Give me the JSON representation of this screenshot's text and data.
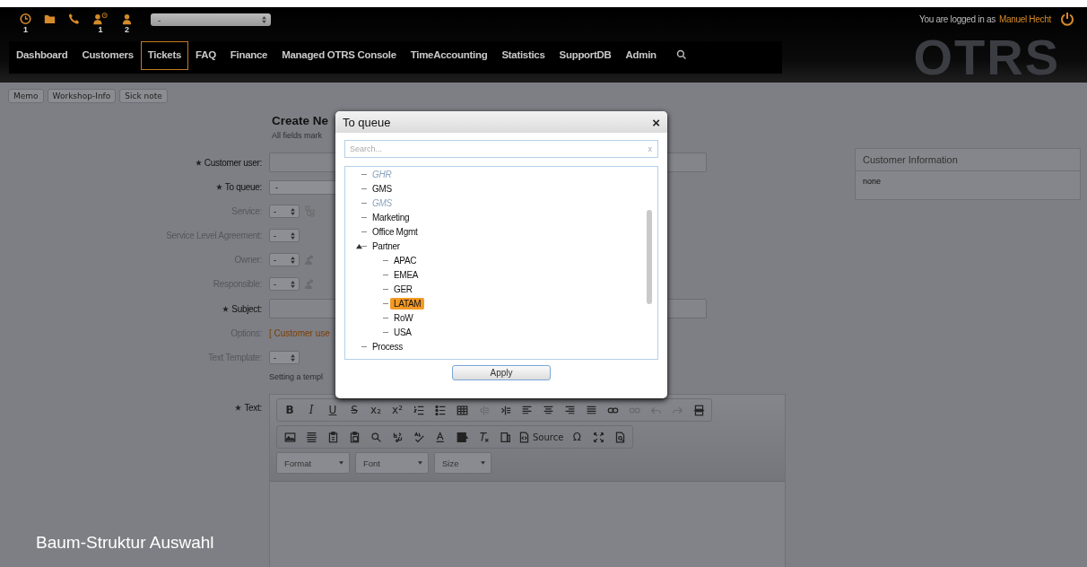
{
  "header": {
    "icons": [
      {
        "kind": "clock",
        "count": "1"
      },
      {
        "kind": "folder"
      },
      {
        "kind": "phone"
      },
      {
        "kind": "reminder",
        "count": "1"
      },
      {
        "kind": "person",
        "count": "2"
      }
    ],
    "queue_select": {
      "value": "-"
    },
    "logo": "OTRS",
    "login_text": "You are logged in as",
    "user": "Manuel Hecht"
  },
  "nav": [
    {
      "label": "Dashboard",
      "selected": false
    },
    {
      "label": "Customers",
      "selected": false
    },
    {
      "label": "Tickets",
      "selected": true
    },
    {
      "label": "FAQ",
      "selected": false
    },
    {
      "label": "Finance",
      "selected": false
    },
    {
      "label": "Managed OTRS Console",
      "selected": false
    },
    {
      "label": "TimeAccounting",
      "selected": false
    },
    {
      "label": "Statistics",
      "selected": false
    },
    {
      "label": "SupportDB",
      "selected": false
    },
    {
      "label": "Admin",
      "selected": false
    }
  ],
  "quick_buttons": [
    "Memo",
    "Workshop-Info",
    "Sick note"
  ],
  "form": {
    "title": "Create Ne",
    "hint": "All fields mark",
    "rows": [
      {
        "label": "Customer user:",
        "required": true,
        "kind": "input"
      },
      {
        "label": "To queue:",
        "required": true,
        "kind": "wide-select",
        "value": "-"
      },
      {
        "label": "Service:",
        "required": false,
        "kind": "select",
        "value": "-"
      },
      {
        "label": "Service Level Agreement:",
        "required": false,
        "kind": "select",
        "value": "-"
      },
      {
        "label": "Owner:",
        "required": false,
        "kind": "select",
        "value": "-"
      },
      {
        "label": "Responsible:",
        "required": false,
        "kind": "select",
        "value": "-"
      },
      {
        "label": "Subject:",
        "required": true,
        "kind": "input"
      },
      {
        "label": "Options:",
        "required": false,
        "kind": "link",
        "value": "[ Customer use"
      },
      {
        "label": "Text Template:",
        "required": false,
        "kind": "select",
        "value": "-",
        "note": "Setting a templ"
      }
    ],
    "text_label": "Text:",
    "text_required": true
  },
  "editor": {
    "toolbar_rows": [
      [
        {
          "kind": "char",
          "label": "B",
          "disabled": false
        },
        {
          "kind": "char",
          "label": "I",
          "disabled": false
        },
        {
          "kind": "char",
          "label": "U",
          "disabled": false
        },
        {
          "kind": "char",
          "label": "S",
          "disabled": false
        },
        {
          "kind": "char",
          "label": "x₂",
          "disabled": false
        },
        {
          "kind": "char",
          "label": "x²",
          "disabled": false
        },
        {
          "kind": "icon",
          "disabled": false
        },
        {
          "kind": "icon",
          "disabled": false
        },
        {
          "kind": "icon",
          "disabled": false
        },
        {
          "kind": "icon",
          "disabled": true
        },
        {
          "kind": "icon",
          "disabled": false
        },
        {
          "kind": "icon",
          "disabled": false
        },
        {
          "kind": "icon",
          "disabled": false
        },
        {
          "kind": "icon",
          "disabled": false
        },
        {
          "kind": "icon",
          "disabled": false
        },
        {
          "kind": "icon",
          "disabled": false
        },
        {
          "kind": "icon",
          "disabled": true
        },
        {
          "kind": "icon",
          "disabled": true
        },
        {
          "kind": "icon",
          "disabled": true
        },
        {
          "kind": "icon",
          "disabled": false
        }
      ],
      [
        {
          "kind": "icon",
          "disabled": false
        },
        {
          "kind": "icon",
          "disabled": false
        },
        {
          "kind": "icon",
          "disabled": false
        },
        {
          "kind": "icon",
          "disabled": false
        },
        {
          "kind": "icon",
          "disabled": false
        },
        {
          "kind": "icon",
          "disabled": false
        },
        {
          "kind": "icon",
          "disabled": false
        },
        {
          "kind": "icon",
          "disabled": false
        },
        {
          "kind": "icon",
          "disabled": false
        },
        {
          "kind": "icon",
          "disabled": false
        },
        {
          "kind": "icon",
          "disabled": false
        },
        {
          "kind": "icon",
          "label": "Source",
          "disabled": false
        },
        {
          "kind": "char",
          "label": "Ω",
          "disabled": false
        },
        {
          "kind": "icon",
          "disabled": false
        },
        {
          "kind": "icon",
          "disabled": false
        }
      ]
    ],
    "dropdowns": [
      "Format",
      "Font",
      "Size"
    ]
  },
  "customer_info": {
    "title": "Customer Information",
    "value": "none"
  },
  "modal": {
    "title": "To queue",
    "close": "×",
    "search": {
      "placeholder": "Search...",
      "clear": "x"
    },
    "tree": [
      {
        "label": "GHR",
        "disabled": true,
        "selected": false
      },
      {
        "label": "GMS",
        "disabled": false,
        "selected": false
      },
      {
        "label": "GMS",
        "disabled": true,
        "selected": false
      },
      {
        "label": "Marketing",
        "disabled": false,
        "selected": false
      },
      {
        "label": "Office Mgmt",
        "disabled": false,
        "selected": false
      },
      {
        "label": "Partner",
        "disabled": false,
        "selected": false,
        "expanded": true,
        "children": [
          {
            "label": "APAC",
            "disabled": false,
            "selected": false
          },
          {
            "label": "EMEA",
            "disabled": false,
            "selected": false
          },
          {
            "label": "GER",
            "disabled": false,
            "selected": false
          },
          {
            "label": "LATAM",
            "disabled": false,
            "selected": true
          },
          {
            "label": "RoW",
            "disabled": false,
            "selected": false
          },
          {
            "label": "USA",
            "disabled": false,
            "selected": false
          }
        ]
      },
      {
        "label": "Process",
        "disabled": false,
        "selected": false
      }
    ],
    "apply": "Apply"
  },
  "caption": "Baum-Struktur Auswahl"
}
